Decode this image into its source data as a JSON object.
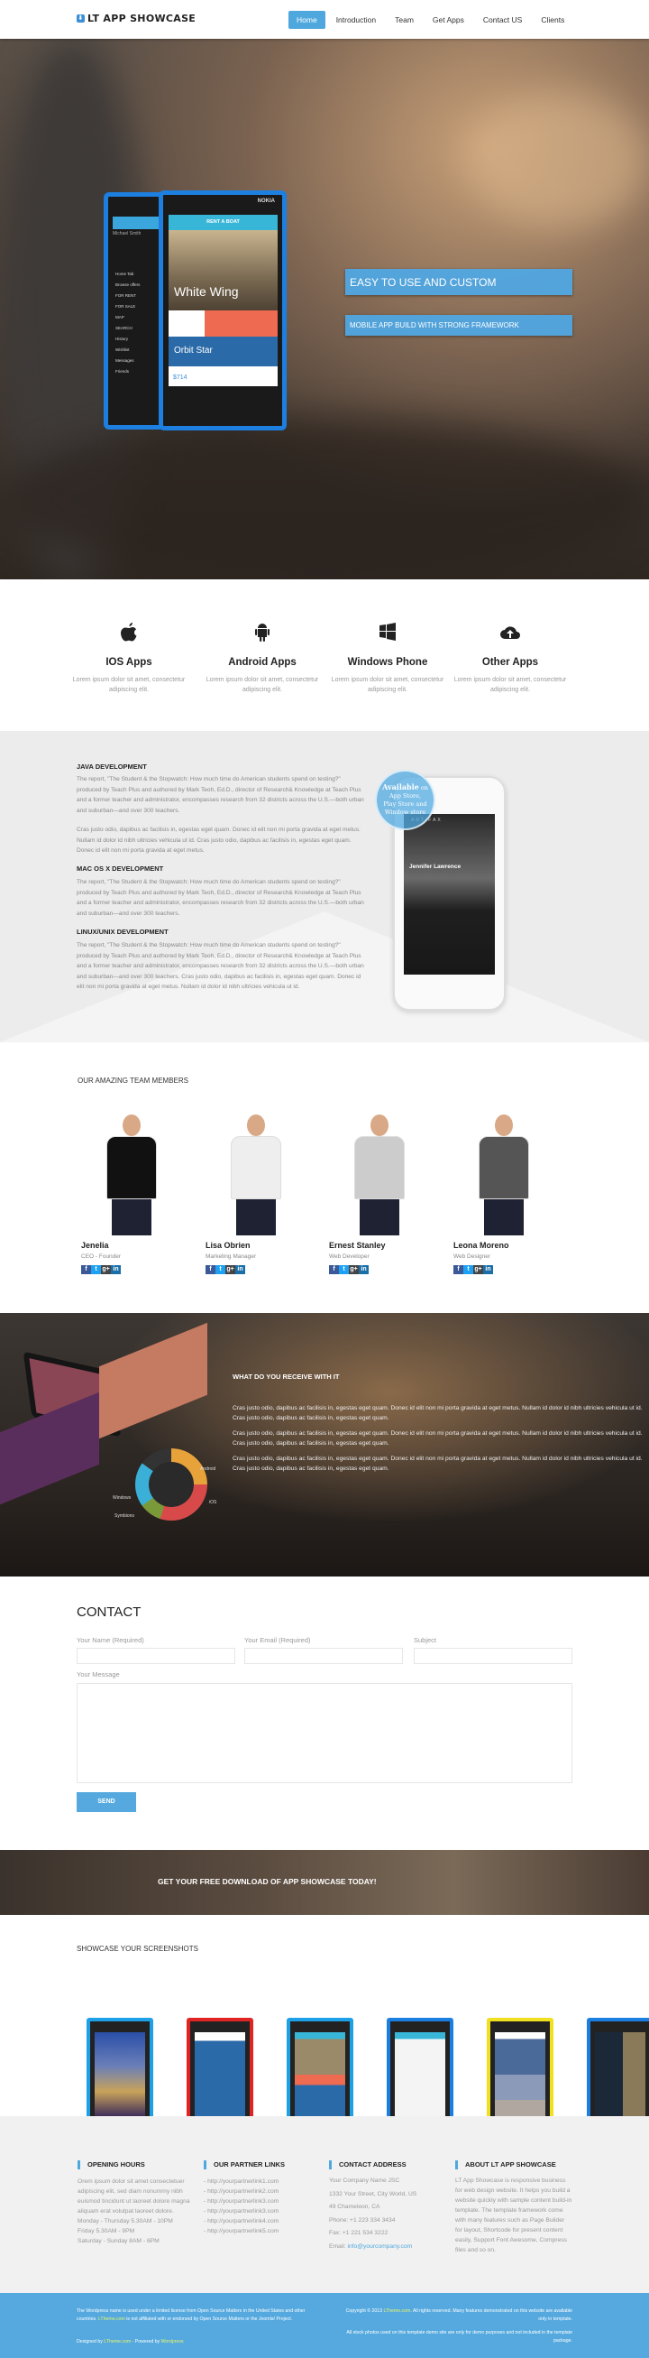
{
  "header": {
    "logo": "LT APP SHOWCASE",
    "nav": [
      "Home",
      "Introduction",
      "Team",
      "Get Apps",
      "Contact US",
      "Clients"
    ],
    "active": "Home"
  },
  "hero": {
    "tagline1": "EASY TO USE AND CUSTOM",
    "tagline2": "MOBILE APP BUILD WITH STRONG FRAMEWORK",
    "phone": {
      "brand": "NOKIA",
      "app_title": "RENT A BOAT",
      "card1": "White Wing",
      "card2": "Orbit Star",
      "price": "$714",
      "menu": [
        "Home Tab",
        "Browse offers",
        "FOR RENT",
        "FOR SALE",
        "MAP",
        "SEARCH",
        "History",
        "Wishlist",
        "Messages",
        "Friends"
      ],
      "user": "Michael Smith"
    }
  },
  "features": [
    {
      "icon": "apple-icon",
      "title": "IOS Apps",
      "text": "Lorem ipsum dolor sit amet, consectetur adipiscing elit."
    },
    {
      "icon": "android-icon",
      "title": "Android Apps",
      "text": "Lorem ipsum dolor sit amet, consectetur adipiscing elit."
    },
    {
      "icon": "windows-icon",
      "title": "Windows Phone",
      "text": "Lorem ipsum dolor sit amet, consectetur adipiscing elit."
    },
    {
      "icon": "cloud-upload-icon",
      "title": "Other Apps",
      "text": "Lorem ipsum dolor sit amet, consectetur adipiscing elit."
    }
  ],
  "development": {
    "java_title": "JAVA DEVELOPMENT",
    "java_p1": "The report, \"The Student & the Stopwatch: How much time do American students spend on testing?\" produced by Teach Plus and authored by Mark Teoh, Ed.D., director of Research& Knowledge at Teach Plus and a former teacher and administrator, encompasses research from 32 districts across the U.S.—both urban and suburban—and over 300 teachers.",
    "java_p2": "Cras justo odio, dapibus ac facilisis in, egestas eget quam. Donec id elit non mi porta gravida at eget metus. Nullam id dolor id nibh ultricies vehicula ut id. Cras justo odio, dapibus ac facilisis in, egestas eget quam. Donec id elit non mi porta gravida at eget metus.",
    "mac_title": "MAC OS X DEVELOPMENT",
    "mac_p": "The report, \"The Student & the Stopwatch: How much time do American students spend on testing?\" produced by Teach Plus and authored by Mark Teoh, Ed.D., director of Research& Knowledge at Teach Plus and a former teacher and administrator, encompasses research from 32 districts across the U.S.—both urban and suburban—and over 300 teachers.",
    "linux_title": "LINUX/UNIX DEVELOPMENT",
    "linux_p": "The report, \"The Student & the Stopwatch: How much time do American students spend on testing?\" produced by Teach Plus and authored by Mark Teoh, Ed.D., director of Research& Knowledge at Teach Plus and a former teacher and administrator, encompasses research from 32 districts across the U.S.—both urban and suburban—and over 300 teachers. Cras justo odio, dapibus ac facilisis in, egestas eget quam. Donec id elit non mi porta gravida at eget metus. Nullam id dolor id nibh ultricies vehicula ut id.",
    "badge_strong": "Available",
    "badge_rest": " on App Store, Play Store and Window store",
    "phone_name": "Jennifer Lawrence",
    "phone_app": "ARTIFAX"
  },
  "team": {
    "title": "OUR AMAZING TEAM MEMBERS",
    "members": [
      {
        "name": "Jenelia",
        "role": "CEO - Founder",
        "shirt": "#111"
      },
      {
        "name": "Lisa Obrien",
        "role": "Marketing Manager",
        "shirt": "#eee"
      },
      {
        "name": "Ernest Stanley",
        "role": "Web Developer",
        "shirt": "#ccc"
      },
      {
        "name": "Leona Moreno",
        "role": "Web Designer",
        "shirt": "#555"
      }
    ],
    "social": [
      "f",
      "t",
      "g+",
      "in"
    ]
  },
  "receive": {
    "title": "WHAT DO YOU RECEIVE WITH IT",
    "line_a": "Cras justo odio, dapibus ac facilisis in, egestas eget quam. Donec id elit non mi porta gravida at eget metus. Nullam id dolor id nibh ultricies vehicula ut id.",
    "line_b": "Cras justo odio, dapibus ac facilisis in, egestas eget quam.",
    "chart_labels": [
      "Android",
      "Windows",
      "iOS",
      "Symbions"
    ]
  },
  "contact": {
    "title": "CONTACT",
    "name_label": "Your Name (Required)",
    "email_label": "Your Email (Required)",
    "subject_label": "Subject",
    "message_label": "Your Message",
    "send": "SEND"
  },
  "cta": {
    "text": "GET YOUR FREE DOWNLOAD OF APP SHOWCASE TODAY!"
  },
  "showcase": {
    "title": "SHOWCASE YOUR SCREENSHOTS",
    "frames": [
      "#1ea0e6",
      "#e02424",
      "#1ea0e6",
      "#1a7fe0",
      "#f0e020",
      "#1a7fe0"
    ]
  },
  "footer": {
    "hours_title": "OPENING HOURS",
    "hours_text": "Orem ipsum dolor sit amet consectetuer adipiscing elit, sed diam nonummy nibh euismod tincidunt ut laoreet dolore magna aliquam erat volutpat laoreet dolore.",
    "hours": [
      "Monday - Thursday 5.30AM - 10PM",
      "Friday 5.30AM - 9PM",
      "Saturday - Sunday 8AM - 6PM"
    ],
    "links_title": "OUR PARTNER LINKS",
    "links": [
      "- http://yourpartnerlink1.com",
      "- http://yourpartnerlink2.com",
      "- http://yourpartnerlink3.com",
      "- http://yourpartnerlink3.com",
      "- http://yourpartnerlink4.com",
      "- http://yourpartnerlink5.com"
    ],
    "address_title": "CONTACT ADDRESS",
    "address": [
      "Your Company Name JSC",
      "1332 Your Street, City World, US",
      "49 Chameleon, CA",
      "Phone: +1 223 334 3434",
      "Fax: +1 221 534 3222"
    ],
    "email_label": "Email: ",
    "email": "info@yourcompany.com",
    "about_title": "ABOUT LT APP SHOWCASE",
    "about_text": "LT App Showcase is responsive business for web design website. It helps you build a website quickly with sample content build-in template. The template framework come with many features such as Page Builder for layout, Shortcode for present content easily, Support Font Awesome, Compress files and so on."
  },
  "bottom": {
    "l1": "The Wordpress name is used under a limited license from Open Source Matters in the United States and other countries. ",
    "l1_link": "LTheme.com",
    "l1_rest": " is not affiliated with or endorsed by Open Source Matters or the Joomla! Project.",
    "designed": "Designed by ",
    "designed_link": "LTheme.com",
    "powered": " - Powered by ",
    "powered_link": "Wordpress",
    "copy": "Copyright © 2013 ",
    "copy_link": "LTheme.com",
    "copy_rest": ". All rights reserved. Many features demonstrated on this website are available only in template.",
    "photos": "All stock photos used on this template demo site are only for demo purposes and not included in the template package."
  }
}
